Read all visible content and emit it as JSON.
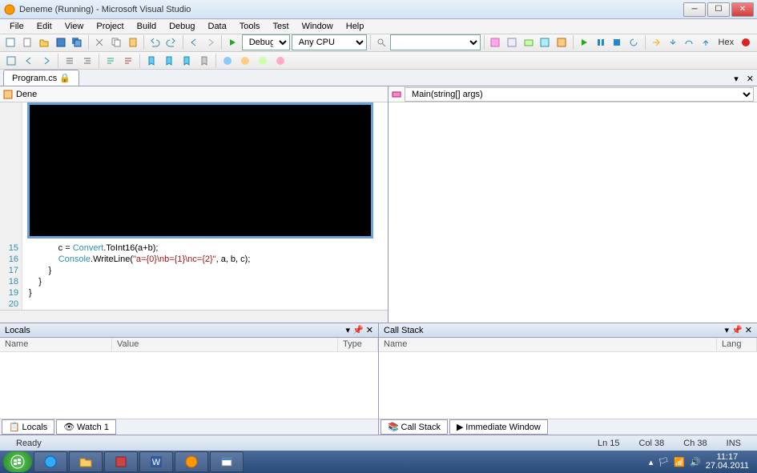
{
  "title": "Deneme (Running) - Microsoft Visual Studio",
  "menu": [
    "File",
    "Edit",
    "View",
    "Project",
    "Build",
    "Debug",
    "Data",
    "Tools",
    "Test",
    "Window",
    "Help"
  ],
  "toolbar": {
    "config": "Debug",
    "platform": "Any CPU",
    "hex": "Hex"
  },
  "docTab": "Program.cs",
  "navLeft": "Dene",
  "navRight": "Main(string[] args)",
  "code": {
    "ln15": "            c = ",
    "ln15_type": "Convert",
    "ln15_rest": ".ToInt16(a+b);",
    "ln16a": "            ",
    "ln16_type": "Console",
    "ln16b": ".WriteLine(",
    "ln16_str": "\"a={0}\\nb={1}\\nc={2}\"",
    "ln16c": ", a, b, c);",
    "ln17": "        }",
    "ln18": "    }",
    "ln19": "}",
    "gutters": [
      "15",
      "16",
      "17",
      "18",
      "19",
      "20"
    ]
  },
  "locals": {
    "title": "Locals",
    "cols": [
      "Name",
      "Value",
      "Type"
    ],
    "tabs": [
      "Locals",
      "Watch 1"
    ]
  },
  "callstack": {
    "title": "Call Stack",
    "cols": [
      "Name",
      "Lang"
    ],
    "tabs": [
      "Call Stack",
      "Immediate Window"
    ]
  },
  "status": {
    "ready": "Ready",
    "ln": "Ln 15",
    "col": "Col 38",
    "ch": "Ch 38",
    "ins": "INS"
  },
  "tray": {
    "time": "11:17",
    "date": "27.04.2011"
  }
}
